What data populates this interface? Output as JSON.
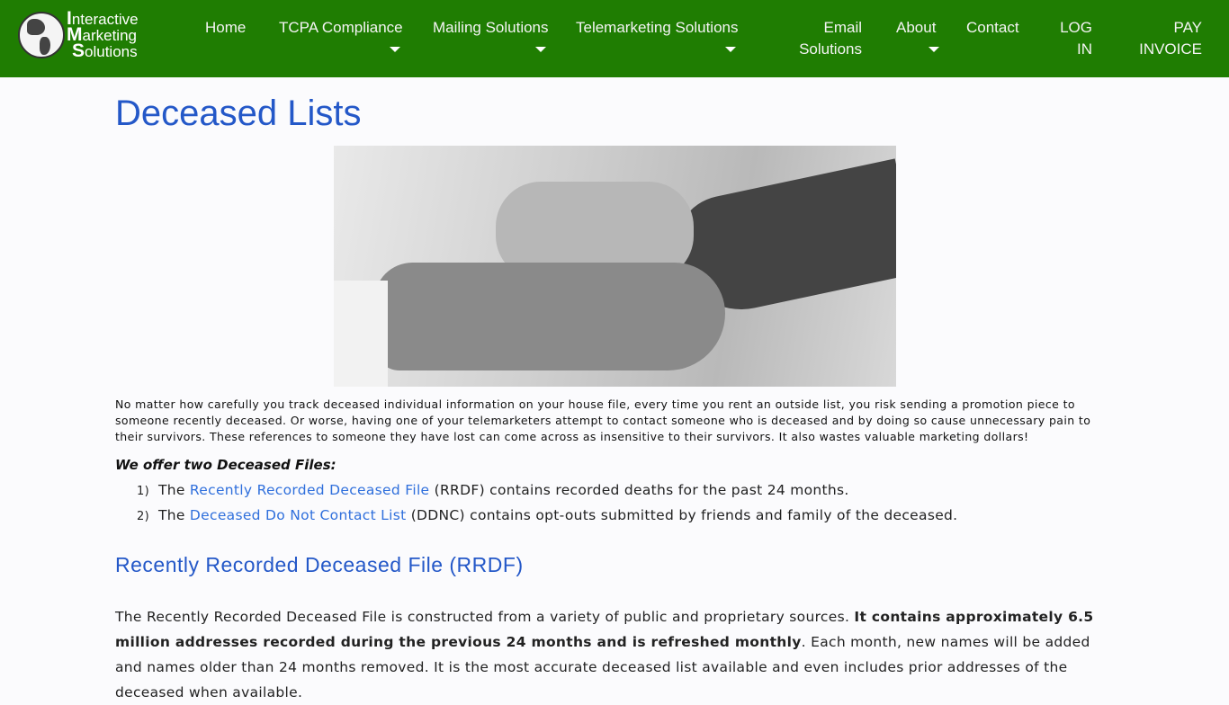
{
  "brand": {
    "line1": "nteractive",
    "line2": "arketing",
    "line3": "olutions",
    "i1": "I",
    "i2": "M",
    "i3": "S"
  },
  "nav": [
    {
      "label": "Home"
    },
    {
      "label": "TCPA Compliance"
    },
    {
      "label": "Mailing Solutions"
    },
    {
      "label": "Telemarketing Solutions"
    },
    {
      "label": "Email Solutions"
    },
    {
      "label": "About"
    },
    {
      "label": "Contact"
    },
    {
      "label": "LOG IN"
    },
    {
      "label": "PAY INVOICE"
    }
  ],
  "colors": {
    "nav_bg": "#1f7d02",
    "heading": "#2458c8",
    "link": "#2f6fdc"
  },
  "page": {
    "title": "Deceased Lists",
    "intro": "No matter how carefully you track deceased individual information on your house file, every time you rent an outside list, you risk sending a promotion piece to someone recently deceased. Or worse, having one of your telemarketers attempt to contact someone who is deceased and by doing so cause unnecessary pain to their survivors. These references to someone they have lost can come across as insensitive to their survivors. It also wastes valuable marketing dollars!",
    "offer": "We offer two Deceased Files:",
    "list": [
      {
        "num": "1)",
        "pre": "The ",
        "link": "Recently Recorded Deceased File",
        "post": " (RRDF) contains recorded deaths for the past 24 months."
      },
      {
        "num": "2)",
        "pre": "The ",
        "link": "Deceased Do Not Contact List",
        "post": " (DDNC) contains opt-outs submitted by friends and family of the deceased."
      }
    ],
    "section_title": "Recently Recorded Deceased File (RRDF)",
    "body_pre": "The Recently Recorded Deceased File is constructed from a variety of public and proprietary sources. ",
    "body_bold": "It contains approximately 6.5 million addresses recorded during the previous 24 months and is refreshed monthly",
    "body_post": ". Each month, new names will be added and names older than 24 months removed. It is the most accurate deceased list available and even includes prior addresses of the deceased when available."
  }
}
